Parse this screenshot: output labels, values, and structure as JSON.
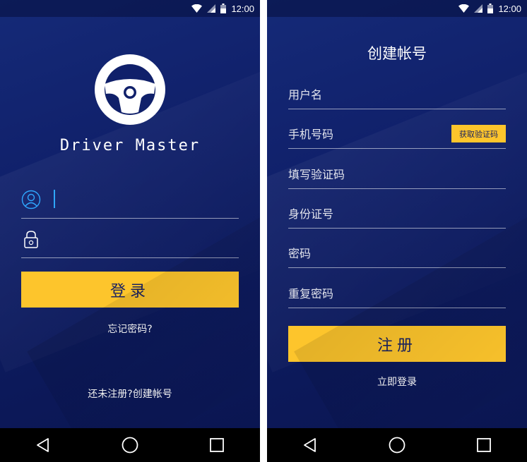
{
  "status_bar": {
    "time": "12:00",
    "icons": [
      "wifi-icon",
      "signal-icon",
      "battery-icon"
    ]
  },
  "login_screen": {
    "app_name": "Driver Master",
    "logo_icon": "steering-wheel-icon",
    "username_icon": "user-icon",
    "password_icon": "lock-icon",
    "login_button": "登录",
    "forgot_password": "忘记密码?",
    "register_prompt": "还未注册?创建帐号"
  },
  "register_screen": {
    "title": "创建帐号",
    "fields": {
      "username": "用户名",
      "phone": "手机号码",
      "code": "填写验证码",
      "id_number": "身份证号",
      "password": "密码",
      "confirm_password": "重复密码"
    },
    "get_code_button": "获取验证码",
    "register_button": "注册",
    "login_now": "立即登录"
  },
  "nav_bar": {
    "icons": [
      "back-icon",
      "home-icon",
      "recents-icon"
    ]
  },
  "colors": {
    "background": "#10206a",
    "accent": "#fdc52c",
    "caret": "#2fa7ff"
  }
}
